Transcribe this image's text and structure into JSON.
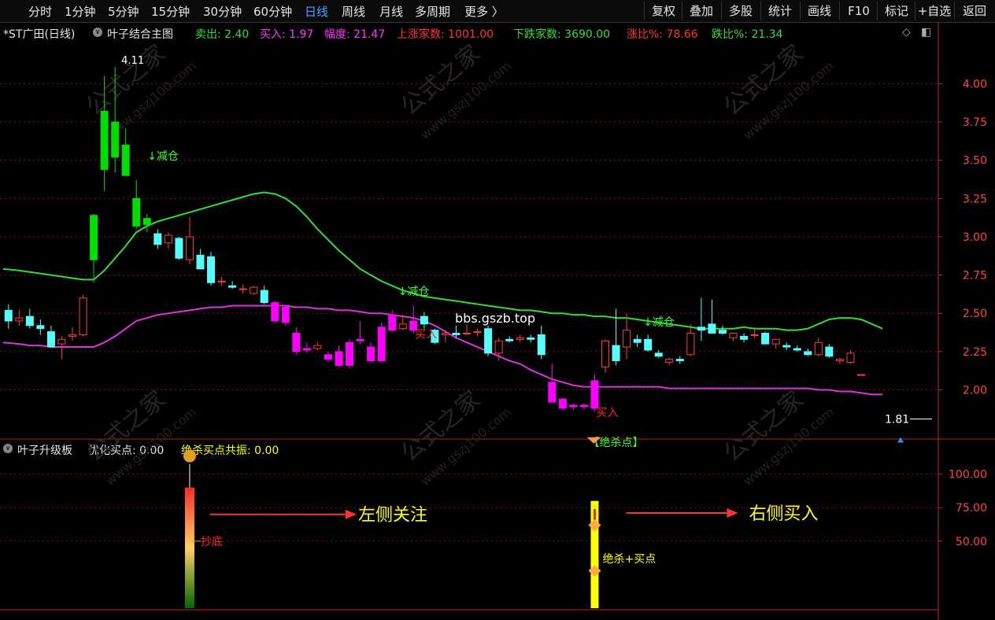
{
  "toolbar": {
    "periods": [
      {
        "label": "分时",
        "active": false
      },
      {
        "label": "1分钟",
        "active": false
      },
      {
        "label": "5分钟",
        "active": false
      },
      {
        "label": "15分钟",
        "active": false
      },
      {
        "label": "30分钟",
        "active": false
      },
      {
        "label": "60分钟",
        "active": false
      },
      {
        "label": "日线",
        "active": true
      },
      {
        "label": "周线",
        "active": false
      },
      {
        "label": "月线",
        "active": false
      },
      {
        "label": "多周期",
        "active": false
      },
      {
        "label": "更多 〉",
        "active": false
      }
    ],
    "buttons": [
      "复权",
      "叠加",
      "多股",
      "统计",
      "画线",
      "F10",
      "标记",
      "+自选",
      "返回"
    ]
  },
  "main_header": {
    "stock": "*ST广田(日线)",
    "indicator": "叶子结合主图",
    "sell": "卖出: 2.40",
    "buy": "买入: 1.97",
    "amplitude": "幅度: 21.47",
    "up_count": "上涨家数: 1001.00",
    "down_count": "下跌家数: 3690.00",
    "up_ratio": "涨比%: 78.66",
    "down_ratio": "跌比%: 21.34"
  },
  "sub_header": {
    "indicator": "叶子升级板",
    "field1": "优化买点: 0.00",
    "field2": "绝杀买点共振: 0.00"
  },
  "annotations": {
    "reduce": "↓减仓",
    "buy": "买入",
    "kill_point": "【绝杀点】",
    "high_label": "4.11",
    "low_label": "1.81",
    "bottom": "抄底",
    "kill_buy": "绝杀+买点",
    "left_focus": "左侧关注",
    "right_buy": "右侧买入",
    "watermark_url": "bbs.gszb.top",
    "watermark_cn": "公式之家",
    "watermark_site": "www.gszj100.com"
  },
  "colors": {
    "up": "#ff3b3b",
    "down": "#55ffff",
    "big_down": "#00dd00",
    "mag_bar": "#ff00ff",
    "upper_band": "#33dd33",
    "lower_band": "#dd33dd",
    "grid": "#7a1010",
    "axis": "#cc2222"
  },
  "chart_data": [
    {
      "type": "candlestick",
      "title": "*ST广田(日线)",
      "ylim": [
        1.72,
        4.3
      ],
      "y_ticks": [
        4.0,
        3.75,
        3.5,
        3.25,
        3.0,
        2.75,
        2.5,
        2.25,
        2.0
      ],
      "grid": true,
      "candles": [
        {
          "o": 2.52,
          "h": 2.56,
          "l": 2.4,
          "c": 2.45
        },
        {
          "o": 2.45,
          "h": 2.52,
          "l": 2.42,
          "c": 2.47
        },
        {
          "o": 2.48,
          "h": 2.53,
          "l": 2.4,
          "c": 2.42
        },
        {
          "o": 2.42,
          "h": 2.46,
          "l": 2.36,
          "c": 2.4
        },
        {
          "o": 2.38,
          "h": 2.42,
          "l": 2.3,
          "c": 2.28
        },
        {
          "o": 2.3,
          "h": 2.35,
          "l": 2.2,
          "c": 2.33
        },
        {
          "o": 2.35,
          "h": 2.41,
          "l": 2.32,
          "c": 2.36
        },
        {
          "o": 2.36,
          "h": 2.62,
          "l": 2.35,
          "c": 2.6
        },
        {
          "o": 2.85,
          "h": 3.15,
          "l": 2.7,
          "c": 3.14,
          "color": "big_down"
        },
        {
          "o": 3.44,
          "h": 4.05,
          "l": 3.3,
          "c": 3.82,
          "color": "big_down"
        },
        {
          "o": 3.75,
          "h": 4.11,
          "l": 3.42,
          "c": 3.52,
          "color": "big_down"
        },
        {
          "o": 3.6,
          "h": 3.71,
          "l": 3.4,
          "c": 3.4,
          "color": "big_down"
        },
        {
          "o": 3.25,
          "h": 3.37,
          "l": 3.05,
          "c": 3.07,
          "color": "big_down"
        },
        {
          "o": 3.08,
          "h": 3.15,
          "l": 3.03,
          "c": 3.12,
          "color": "big_down"
        },
        {
          "o": 3.02,
          "h": 3.05,
          "l": 2.92,
          "c": 2.95
        },
        {
          "o": 2.96,
          "h": 3.03,
          "l": 2.92,
          "c": 3.01
        },
        {
          "o": 2.99,
          "h": 3.0,
          "l": 2.85,
          "c": 2.86
        },
        {
          "o": 2.85,
          "h": 3.13,
          "l": 2.82,
          "c": 3.0
        },
        {
          "o": 2.88,
          "h": 2.92,
          "l": 2.79,
          "c": 2.79
        },
        {
          "o": 2.87,
          "h": 2.9,
          "l": 2.68,
          "c": 2.7
        },
        {
          "o": 2.71,
          "h": 2.74,
          "l": 2.68,
          "c": 2.71
        },
        {
          "o": 2.68,
          "h": 2.71,
          "l": 2.66,
          "c": 2.67
        },
        {
          "o": 2.66,
          "h": 2.69,
          "l": 2.63,
          "c": 2.66
        },
        {
          "o": 2.63,
          "h": 2.68,
          "l": 2.62,
          "c": 2.67
        },
        {
          "o": 2.65,
          "h": 2.68,
          "l": 2.56,
          "c": 2.57
        },
        {
          "o": 2.57,
          "h": 2.58,
          "l": 2.44,
          "c": 2.45,
          "color": "mag_bar"
        },
        {
          "o": 2.54,
          "h": 2.55,
          "l": 2.42,
          "c": 2.44,
          "color": "mag_bar"
        },
        {
          "o": 2.37,
          "h": 2.41,
          "l": 2.23,
          "c": 2.25,
          "color": "mag_bar"
        },
        {
          "o": 2.27,
          "h": 2.31,
          "l": 2.24,
          "c": 2.26,
          "color": "mag_bar"
        },
        {
          "o": 2.27,
          "h": 2.31,
          "l": 2.26,
          "c": 2.29
        },
        {
          "o": 2.23,
          "h": 2.25,
          "l": 2.18,
          "c": 2.2,
          "color": "mag_bar"
        },
        {
          "o": 2.25,
          "h": 2.29,
          "l": 2.15,
          "c": 2.16,
          "color": "mag_bar"
        },
        {
          "o": 2.31,
          "h": 2.33,
          "l": 2.14,
          "c": 2.16,
          "color": "mag_bar"
        },
        {
          "o": 2.32,
          "h": 2.45,
          "l": 2.3,
          "c": 2.33,
          "color": "mag_bar"
        },
        {
          "o": 2.28,
          "h": 2.31,
          "l": 2.18,
          "c": 2.19,
          "color": "mag_bar"
        },
        {
          "o": 2.41,
          "h": 2.44,
          "l": 2.18,
          "c": 2.19,
          "color": "mag_bar"
        },
        {
          "o": 2.49,
          "h": 2.52,
          "l": 2.38,
          "c": 2.39,
          "color": "mag_bar"
        },
        {
          "o": 2.4,
          "h": 2.49,
          "l": 2.39,
          "c": 2.43
        },
        {
          "o": 2.45,
          "h": 2.55,
          "l": 2.37,
          "c": 2.39,
          "color": "mag_bar"
        },
        {
          "o": 2.48,
          "h": 2.51,
          "l": 2.4,
          "c": 2.43
        },
        {
          "o": 2.39,
          "h": 2.4,
          "l": 2.3,
          "c": 2.31
        },
        {
          "o": 2.36,
          "h": 2.39,
          "l": 2.31,
          "c": 2.37
        },
        {
          "o": 2.37,
          "h": 2.42,
          "l": 2.34,
          "c": 2.36
        },
        {
          "o": 2.37,
          "h": 2.43,
          "l": 2.36,
          "c": 2.37
        },
        {
          "o": 2.38,
          "h": 2.4,
          "l": 2.35,
          "c": 2.38
        },
        {
          "o": 2.4,
          "h": 2.42,
          "l": 2.22,
          "c": 2.24
        },
        {
          "o": 2.24,
          "h": 2.34,
          "l": 2.19,
          "c": 2.32
        },
        {
          "o": 2.33,
          "h": 2.35,
          "l": 2.31,
          "c": 2.32
        },
        {
          "o": 2.33,
          "h": 2.36,
          "l": 2.31,
          "c": 2.34
        },
        {
          "o": 2.34,
          "h": 2.36,
          "l": 2.31,
          "c": 2.33
        },
        {
          "o": 2.36,
          "h": 2.42,
          "l": 2.2,
          "c": 2.23
        },
        {
          "o": 2.05,
          "h": 2.17,
          "l": 1.92,
          "c": 1.92,
          "color": "mag_bar"
        },
        {
          "o": 1.94,
          "h": 1.95,
          "l": 1.87,
          "c": 1.88,
          "color": "mag_bar"
        },
        {
          "o": 1.9,
          "h": 1.91,
          "l": 1.87,
          "c": 1.89,
          "color": "mag_bar"
        },
        {
          "o": 1.9,
          "h": 1.91,
          "l": 1.87,
          "c": 1.89,
          "color": "mag_bar"
        },
        {
          "o": 1.88,
          "h": 2.1,
          "l": 1.86,
          "c": 2.06,
          "color": "mag_bar"
        },
        {
          "o": 2.15,
          "h": 2.33,
          "l": 2.11,
          "c": 2.32
        },
        {
          "o": 2.29,
          "h": 2.53,
          "l": 2.16,
          "c": 2.19
        },
        {
          "o": 2.28,
          "h": 2.5,
          "l": 2.2,
          "c": 2.39
        },
        {
          "o": 2.33,
          "h": 2.36,
          "l": 2.28,
          "c": 2.31
        },
        {
          "o": 2.33,
          "h": 2.36,
          "l": 2.25,
          "c": 2.26
        },
        {
          "o": 2.24,
          "h": 2.26,
          "l": 2.21,
          "c": 2.22
        },
        {
          "o": 2.18,
          "h": 2.21,
          "l": 2.16,
          "c": 2.2
        },
        {
          "o": 2.2,
          "h": 2.22,
          "l": 2.17,
          "c": 2.19
        },
        {
          "o": 2.23,
          "h": 2.43,
          "l": 2.22,
          "c": 2.37
        },
        {
          "o": 2.41,
          "h": 2.6,
          "l": 2.32,
          "c": 2.39
        },
        {
          "o": 2.43,
          "h": 2.59,
          "l": 2.4,
          "c": 2.37
        },
        {
          "o": 2.39,
          "h": 2.42,
          "l": 2.36,
          "c": 2.37
        },
        {
          "o": 2.34,
          "h": 2.37,
          "l": 2.32,
          "c": 2.37
        },
        {
          "o": 2.35,
          "h": 2.37,
          "l": 2.31,
          "c": 2.33
        },
        {
          "o": 2.36,
          "h": 2.41,
          "l": 2.34,
          "c": 2.36
        },
        {
          "o": 2.37,
          "h": 2.38,
          "l": 2.3,
          "c": 2.3
        },
        {
          "o": 2.3,
          "h": 2.33,
          "l": 2.27,
          "c": 2.33
        },
        {
          "o": 2.29,
          "h": 2.31,
          "l": 2.26,
          "c": 2.28
        },
        {
          "o": 2.27,
          "h": 2.29,
          "l": 2.25,
          "c": 2.26
        },
        {
          "o": 2.25,
          "h": 2.27,
          "l": 2.22,
          "c": 2.23
        },
        {
          "o": 2.23,
          "h": 2.34,
          "l": 2.22,
          "c": 2.31
        },
        {
          "o": 2.28,
          "h": 2.3,
          "l": 2.21,
          "c": 2.22
        },
        {
          "o": 2.19,
          "h": 2.21,
          "l": 2.17,
          "c": 2.2
        },
        {
          "o": 2.18,
          "h": 2.26,
          "l": 2.17,
          "c": 2.24
        },
        {
          "o": 2.1,
          "h": 2.1,
          "l": 2.1,
          "c": 2.1
        }
      ],
      "series": [
        {
          "name": "上轨",
          "values": [
            2.79,
            2.78,
            2.77,
            2.76,
            2.75,
            2.74,
            2.73,
            2.72,
            2.72,
            2.78,
            2.86,
            2.94,
            3.03,
            3.07,
            3.1,
            3.12,
            3.14,
            3.16,
            3.18,
            3.2,
            3.22,
            3.24,
            3.26,
            3.28,
            3.29,
            3.28,
            3.25,
            3.2,
            3.13,
            3.05,
            2.98,
            2.91,
            2.85,
            2.79,
            2.75,
            2.71,
            2.68,
            2.65,
            2.63,
            2.61,
            2.6,
            2.59,
            2.58,
            2.57,
            2.56,
            2.55,
            2.54,
            2.53,
            2.52,
            2.52,
            2.51,
            2.5,
            2.5,
            2.49,
            2.49,
            2.48,
            2.48,
            2.47,
            2.47,
            2.46,
            2.45,
            2.44,
            2.43,
            2.42,
            2.41,
            2.4,
            2.4,
            2.4,
            2.4,
            2.41,
            2.4,
            2.4,
            2.4,
            2.39,
            2.39,
            2.4,
            2.43,
            2.46,
            2.47,
            2.47,
            2.46,
            2.43,
            2.4
          ]
        },
        {
          "name": "下轨",
          "values": [
            2.31,
            2.3,
            2.29,
            2.29,
            2.28,
            2.28,
            2.28,
            2.28,
            2.28,
            2.31,
            2.35,
            2.4,
            2.45,
            2.47,
            2.49,
            2.5,
            2.51,
            2.52,
            2.53,
            2.54,
            2.54,
            2.55,
            2.55,
            2.55,
            2.55,
            2.55,
            2.55,
            2.54,
            2.54,
            2.53,
            2.53,
            2.52,
            2.52,
            2.51,
            2.5,
            2.5,
            2.49,
            2.48,
            2.47,
            2.45,
            2.42,
            2.38,
            2.34,
            2.31,
            2.28,
            2.25,
            2.22,
            2.19,
            2.17,
            2.13,
            2.1,
            2.07,
            2.05,
            2.03,
            2.02,
            2.02,
            2.02,
            2.02,
            2.02,
            2.02,
            2.02,
            2.02,
            2.01,
            2.01,
            2.01,
            2.01,
            2.01,
            2.01,
            2.01,
            2.01,
            2.01,
            2.01,
            2.01,
            2.01,
            2.01,
            2.01,
            2.0,
            2.0,
            1.99,
            1.99,
            1.98,
            1.97,
            1.97
          ]
        }
      ],
      "markers": [
        {
          "i": 12,
          "text": "↓减仓",
          "at": "top"
        },
        {
          "i": 37,
          "text": "↓减仓",
          "at": "band"
        },
        {
          "i": 60,
          "text": "↓减仓",
          "at": "band"
        },
        {
          "i": 38,
          "text": "买入",
          "at": "below"
        },
        {
          "i": 55,
          "text": "买入",
          "at": "below"
        },
        {
          "i": 55,
          "text": "【绝杀点】",
          "at": "kill"
        }
      ]
    },
    {
      "type": "bar",
      "title": "叶子升级板",
      "ylim": [
        0,
        125
      ],
      "y_ticks": [
        100.0,
        75.0,
        50.0
      ],
      "bars": [
        {
          "i": 17,
          "value": 90,
          "gradient": [
            "#ff2a2a",
            "#ffd060",
            "#006600"
          ],
          "label": "抄底"
        },
        {
          "i": 55,
          "value": 80,
          "solid": "#ffff00",
          "label": "绝杀+买点"
        }
      ]
    }
  ]
}
